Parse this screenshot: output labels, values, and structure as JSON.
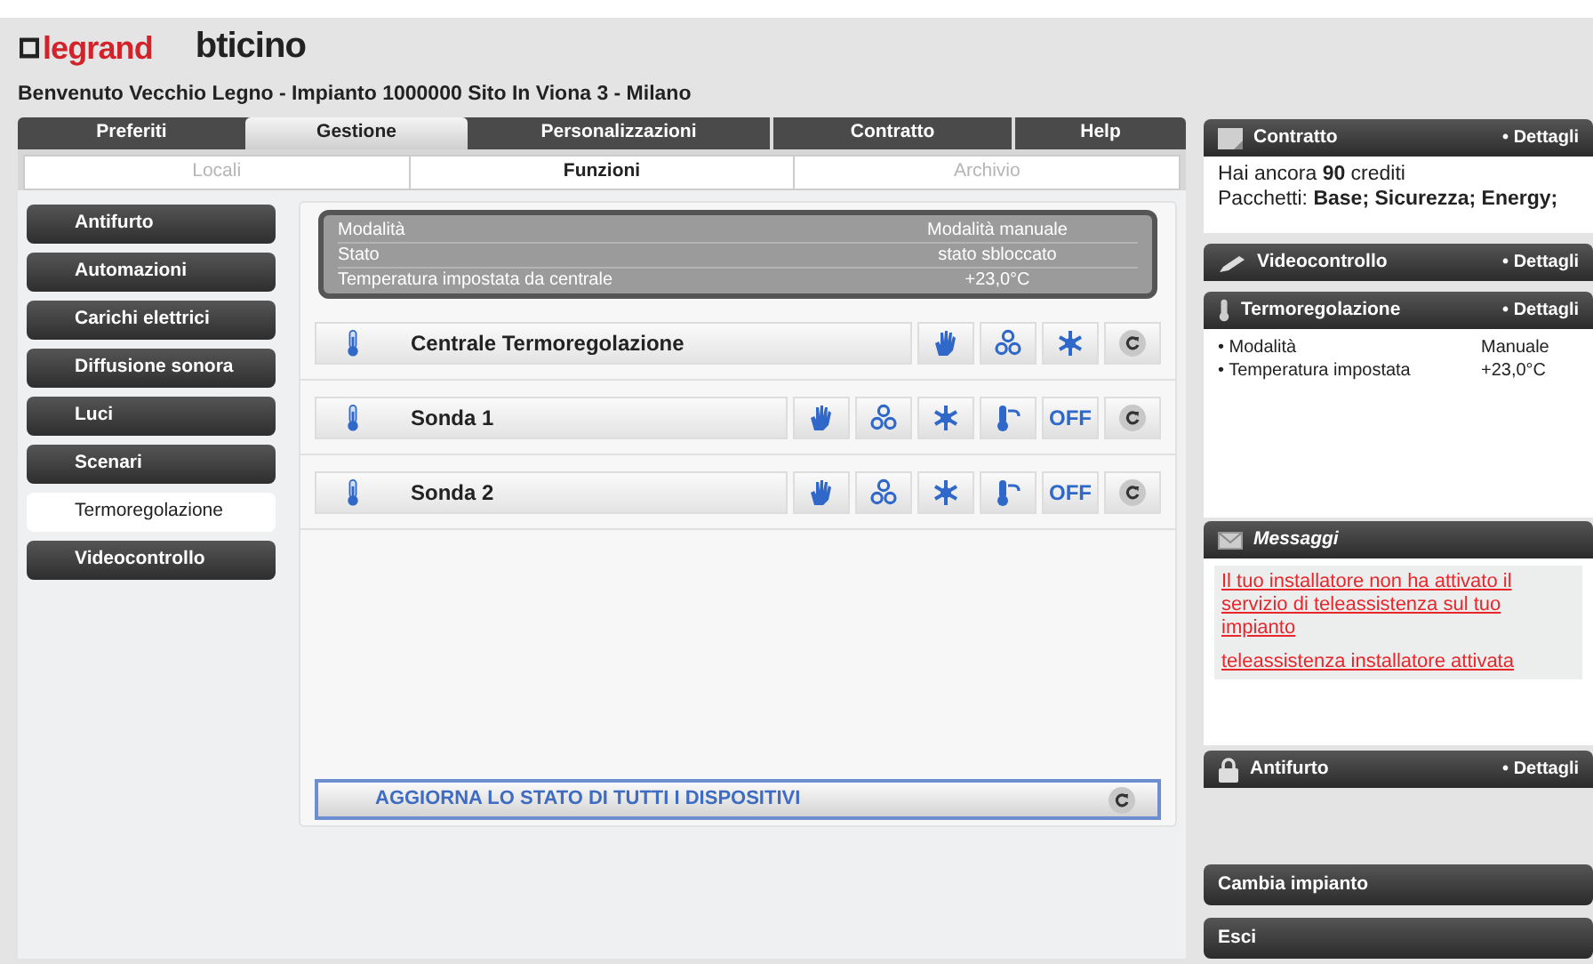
{
  "brand": {
    "logo_1": "legrand",
    "logo_2": "bticino"
  },
  "welcome": "Benvenuto Vecchio Legno - Impianto 1000000 Sito In Viona 3 - Milano",
  "tabs": [
    {
      "label": "Preferiti",
      "selected": false
    },
    {
      "label": "Gestione",
      "selected": true
    },
    {
      "label": "Personalizzazioni",
      "selected": false
    },
    {
      "label": "Contratto",
      "selected": false
    },
    {
      "label": "Help",
      "selected": false
    }
  ],
  "subtabs": [
    {
      "label": "Locali",
      "selected": false
    },
    {
      "label": "Funzioni",
      "selected": true
    },
    {
      "label": "Archivio",
      "selected": false
    }
  ],
  "sidebar": {
    "items": [
      {
        "label": "Antifurto",
        "selected": false
      },
      {
        "label": "Automazioni",
        "selected": false
      },
      {
        "label": "Carichi elettrici",
        "selected": false
      },
      {
        "label": "Diffusione sonora",
        "selected": false
      },
      {
        "label": "Luci",
        "selected": false
      },
      {
        "label": "Scenari",
        "selected": false
      },
      {
        "label": "Termoregolazione",
        "selected": true
      },
      {
        "label": "Videocontrollo",
        "selected": false
      }
    ]
  },
  "status": [
    {
      "label": "Modalità",
      "value": "Modalità manuale"
    },
    {
      "label": "Stato",
      "value": "stato sbloccato"
    },
    {
      "label": "Temperatura impostata da centrale",
      "value": "+23,0°C"
    }
  ],
  "devices": [
    {
      "name": "Centrale Termoregolazione",
      "buttons": [
        {
          "kind": "manual"
        },
        {
          "kind": "antifreeze"
        },
        {
          "kind": "snow"
        },
        {
          "kind": "refresh"
        }
      ]
    },
    {
      "name": "Sonda 1",
      "buttons": [
        {
          "kind": "manual"
        },
        {
          "kind": "antifreeze"
        },
        {
          "kind": "snow"
        },
        {
          "kind": "probe"
        },
        {
          "kind": "off",
          "label": "OFF"
        },
        {
          "kind": "refresh"
        }
      ]
    },
    {
      "name": "Sonda 2",
      "buttons": [
        {
          "kind": "manual"
        },
        {
          "kind": "antifreeze"
        },
        {
          "kind": "snow"
        },
        {
          "kind": "probe"
        },
        {
          "kind": "off",
          "label": "OFF"
        },
        {
          "kind": "refresh"
        }
      ]
    }
  ],
  "refresh_all": "AGGIORNA LO STATO DI TUTTI I DISPOSITIVI",
  "right_panels": {
    "contratto": {
      "title": "Contratto",
      "link": "• Dettagli",
      "credits": "Hai ancora **90** crediti",
      "packages": "Pacchetti: **Base; Sicurezza; Energy;**"
    },
    "videocontrollo": {
      "title": "Videocontrollo",
      "link": "• Dettagli"
    },
    "termoregolazione": {
      "title": "Termoregolazione",
      "link": "• Dettagli",
      "rows": [
        {
          "label": "• Modalità",
          "value": "Manuale"
        },
        {
          "label": "• Temperatura impostata",
          "value": "+23,0°C"
        }
      ]
    },
    "messaggi": {
      "title": "Messaggi",
      "messages": [
        "Il tuo installatore non ha attivato il servizio di teleassistenza sul tuo impianto",
        "teleassistenza installatore attivata"
      ]
    },
    "antifurto": {
      "title": "Antifurto",
      "link": "• Dettagli"
    },
    "buttons": [
      "Cambia impianto",
      "Esci"
    ]
  }
}
